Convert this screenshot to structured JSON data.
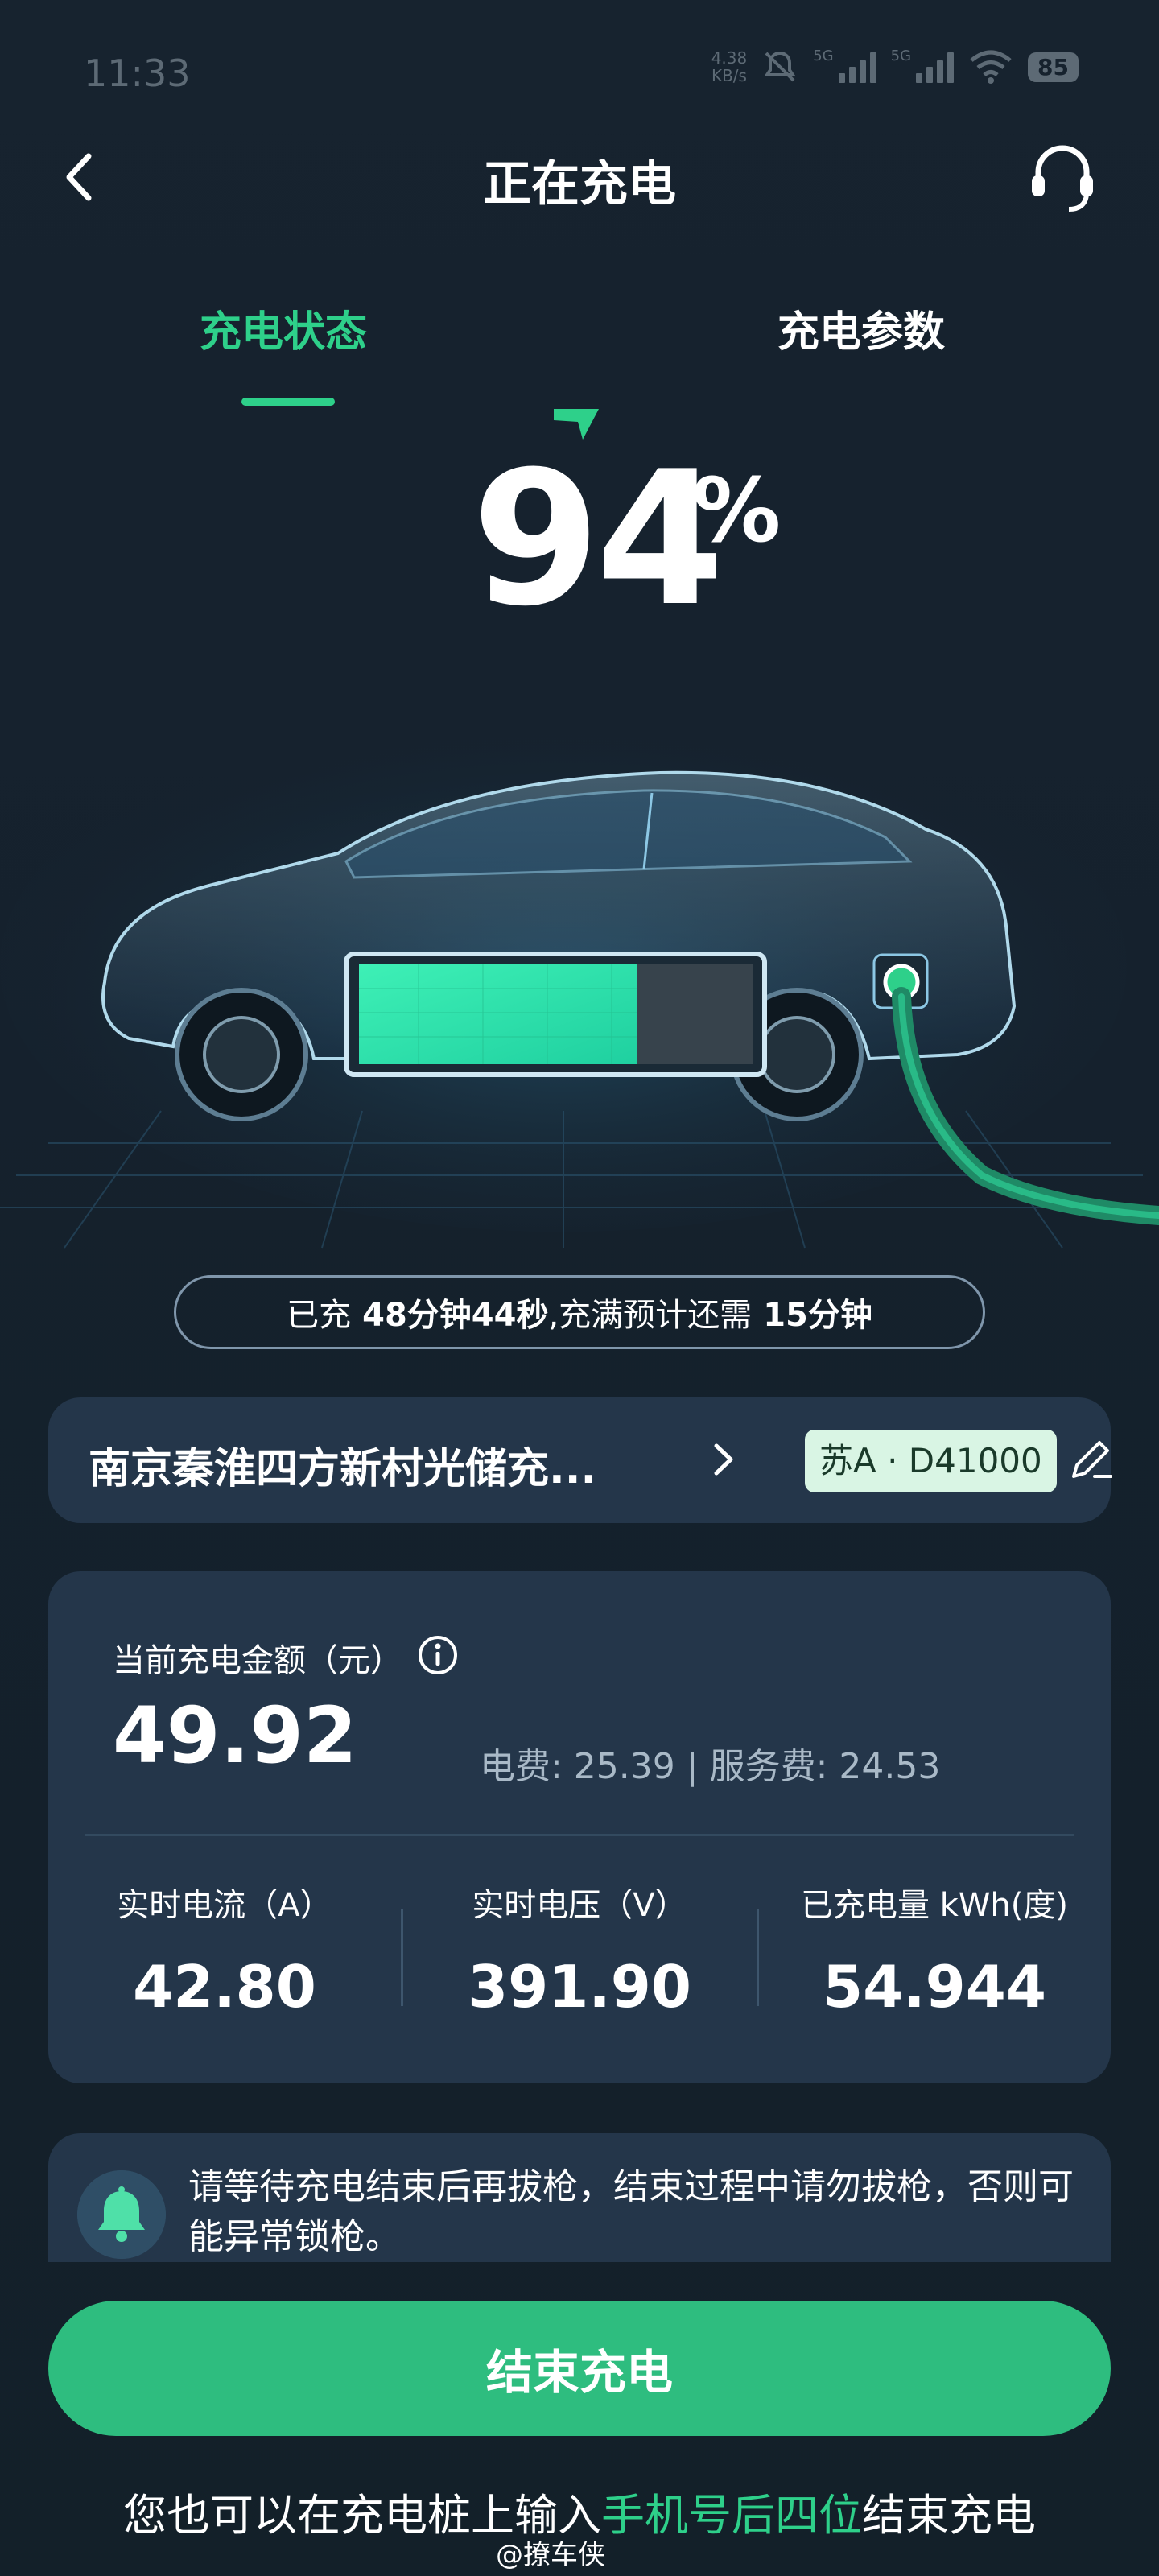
{
  "status_bar": {
    "time": "11:33",
    "speed_value": "4.38",
    "speed_unit": "KB/s",
    "net1": "5G",
    "net2": "5G",
    "battery": "85"
  },
  "header": {
    "title": "正在充电"
  },
  "tabs": [
    {
      "label": "充电状态",
      "active": true
    },
    {
      "label": "充电参数",
      "active": false
    }
  ],
  "charge": {
    "percent": "94",
    "percent_sign": "%",
    "battery_level": 0.94
  },
  "time_pill": {
    "prefix": "已充",
    "elapsed": "48分钟44秒",
    "middle": ",充满预计还需",
    "remaining": "15分钟"
  },
  "station": {
    "name": "南京秦淮四方新村光储充...",
    "plate": "苏A · D41000"
  },
  "fee": {
    "label": "当前充电金额（元）",
    "amount": "49.92",
    "detail": "电费: 25.39 | 服务费: 24.53"
  },
  "metrics": [
    {
      "label": "实时电流（A）",
      "value": "42.80"
    },
    {
      "label": "实时电压（V）",
      "value": "391.90"
    },
    {
      "label": "已充电量 kWh(度)",
      "value": "54.944"
    }
  ],
  "notice": {
    "text": "请等待充电结束后再拔枪，结束过程中请勿拔枪，否则可能异常锁枪。"
  },
  "end_button": {
    "label": "结束充电"
  },
  "footer": {
    "prefix": "您也可以在充电桩上输入",
    "highlight": "手机号后四位",
    "suffix": "结束充电"
  },
  "watermark": "@撩车侠",
  "colors": {
    "accent": "#2ed08a",
    "card": "#24364a",
    "background": "#16222e",
    "button": "#2ebd7f"
  }
}
